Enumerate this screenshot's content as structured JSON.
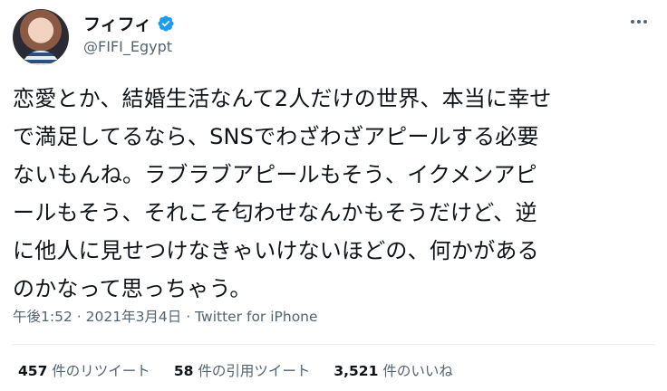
{
  "author": {
    "display_name": "フィフィ",
    "handle": "@FIFI_Egypt",
    "verified_color": "#1d9bf0"
  },
  "tweet": {
    "text": "恋愛とか、結婚生活なんて2人だけの世界、本当に幸せ\nで満足してるなら、SNSでわざわざアピールする必要\nないもんね。ラブラブアピールもそう、イクメンアピ\nールもそう、それこそ匂わせなんかもそうだけど、逆\nに他人に見せつけなきゃいけないほどの、何かがある\nのかなって思っちゃう。",
    "time": "午後1:52",
    "date": "2021年3月4日",
    "separator": "·",
    "source": "Twitter for iPhone"
  },
  "stats": {
    "retweets_count": "457",
    "retweets_label": "件のリツイート",
    "quotes_count": "58",
    "quotes_label": "件の引用ツイート",
    "likes_count": "3,521",
    "likes_label": "件のいいね"
  },
  "icons": [
    "verified-badge-icon",
    "more-options-icon"
  ]
}
